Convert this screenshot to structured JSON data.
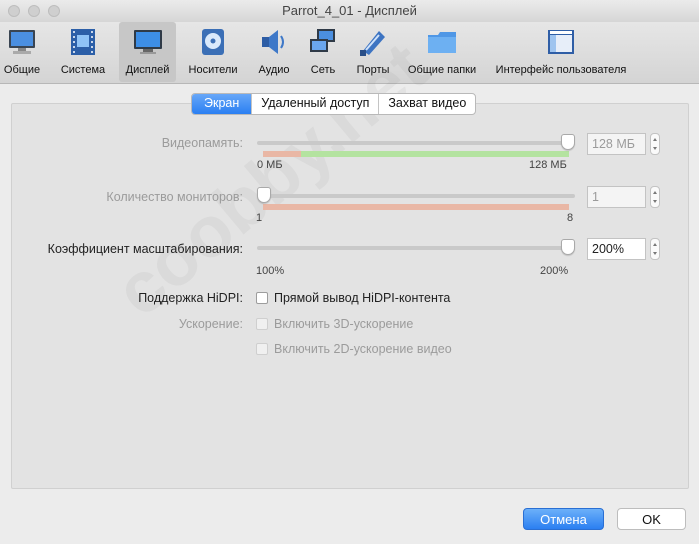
{
  "window": {
    "title": "Parrot_4_01 - Дисплей"
  },
  "toolbar": {
    "items": [
      {
        "label": "Общие",
        "icon": "general-monitor-icon"
      },
      {
        "label": "Система",
        "icon": "system-chip-icon"
      },
      {
        "label": "Дисплей",
        "icon": "display-monitor-icon",
        "active": true
      },
      {
        "label": "Носители",
        "icon": "storage-disk-icon"
      },
      {
        "label": "Аудио",
        "icon": "audio-speaker-icon"
      },
      {
        "label": "Сеть",
        "icon": "network-icon"
      },
      {
        "label": "Порты",
        "icon": "ports-icon"
      },
      {
        "label": "Общие папки",
        "icon": "shared-folder-icon"
      },
      {
        "label": "Интерфейс пользователя",
        "icon": "user-interface-icon"
      }
    ]
  },
  "tabs": [
    "Экран",
    "Удаленный доступ",
    "Захват видео"
  ],
  "active_tab": "Экран",
  "video_memory": {
    "label": "Видеопамять:",
    "value": "128 МБ",
    "min": "0 МБ",
    "max": "128 МБ",
    "fraction": 1.0
  },
  "monitors": {
    "label": "Количество мониторов:",
    "value": "1",
    "min": "1",
    "max": "8",
    "fraction": 0.0
  },
  "scale": {
    "label": "Коэффициент масштабирования:",
    "value": "200%",
    "min": "100%",
    "max": "200%",
    "fraction": 1.0
  },
  "hidpi": {
    "label": "Поддержка HiDPI:",
    "checkbox": "Прямой вывод HiDPI-контента",
    "checked": false
  },
  "acceleration": {
    "label": "Ускорение:",
    "option_3d": "Включить 3D-ускорение",
    "option_2d": "Включить 2D-ускорение видео"
  },
  "buttons": {
    "cancel": "Отмена",
    "ok": "OK"
  },
  "watermark": "coobby.net",
  "colors": {
    "accent": "#2a7ff2",
    "green": "#b4e3a0",
    "salmon": "#e9b7a5"
  }
}
